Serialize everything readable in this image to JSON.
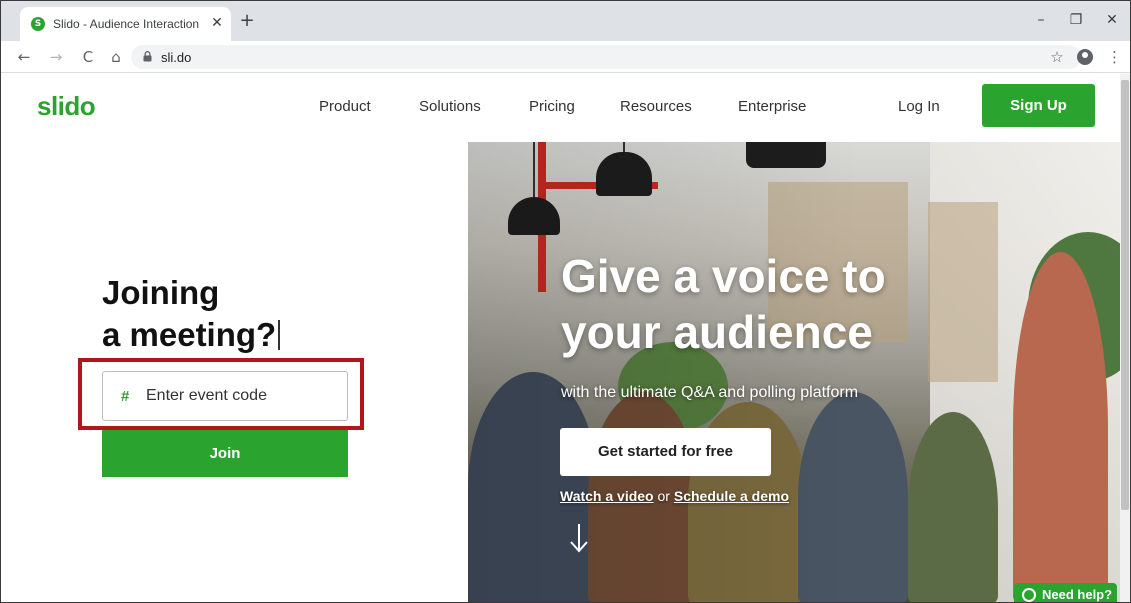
{
  "browser": {
    "tab_title": "Slido - Audience Interaction Mad",
    "tab_favicon_letter": "S",
    "tab_close": "✕",
    "new_tab": "+",
    "window_controls": {
      "minimize": "–",
      "restore": "❐",
      "close": "✕"
    },
    "nav": {
      "back": "←",
      "forward": "→",
      "reload": "C",
      "home": "⌂"
    },
    "url": "sli.do",
    "star": "☆",
    "menu": "⋮"
  },
  "site": {
    "logo": "slido",
    "nav_items": [
      "Product",
      "Solutions",
      "Pricing",
      "Resources",
      "Enterprise"
    ],
    "login": "Log In",
    "signup": "Sign Up"
  },
  "join": {
    "heading_line1": "Joining",
    "heading_line2": "a meeting?",
    "hash": "#",
    "placeholder": "Enter event code",
    "button": "Join"
  },
  "hero": {
    "title_line1": "Give a voice to",
    "title_line2": "your audience",
    "subtitle": "with the ultimate Q&A and polling platform",
    "cta": "Get started for free",
    "link_video": "Watch a video",
    "link_or": " or ",
    "link_demo": "Schedule a demo"
  },
  "help": {
    "label": "Need help?"
  },
  "colors": {
    "brand_green": "#2aa42f",
    "highlight_red": "#b0161b"
  }
}
